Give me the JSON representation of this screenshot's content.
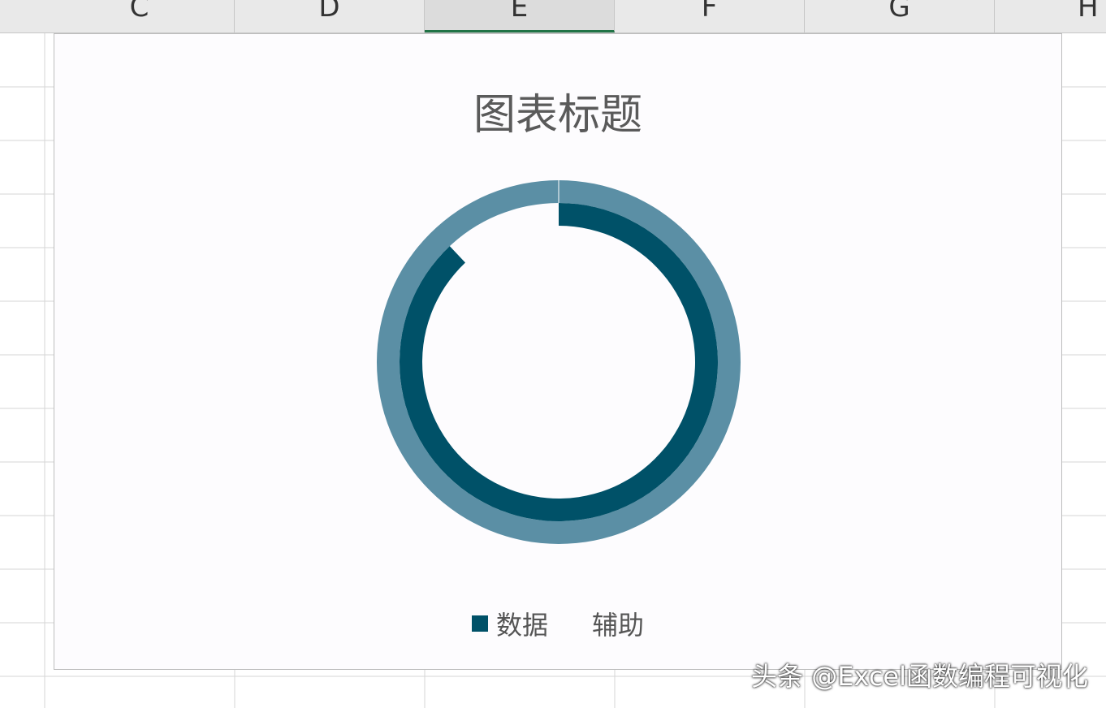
{
  "spreadsheet": {
    "columns": [
      "C",
      "D",
      "E",
      "F",
      "G",
      "H"
    ],
    "active_column": "E"
  },
  "chart_data": {
    "type": "doughnut",
    "title": "图表标题",
    "series": [
      {
        "name": "数据",
        "values": [
          88,
          12
        ],
        "ring": "inner",
        "color": "#005168"
      },
      {
        "name": "辅助",
        "values": [
          100
        ],
        "ring": "outer",
        "color": "#5b8fa5"
      }
    ],
    "legend": [
      {
        "label": "数据",
        "color": "#005168",
        "show_swatch": true
      },
      {
        "label": "辅助",
        "color": "#5b8fa5",
        "show_swatch": false
      }
    ],
    "legend_position": "bottom",
    "start_angle": 0,
    "direction": "clockwise"
  },
  "watermark": "头条 @Excel函数编程可视化"
}
